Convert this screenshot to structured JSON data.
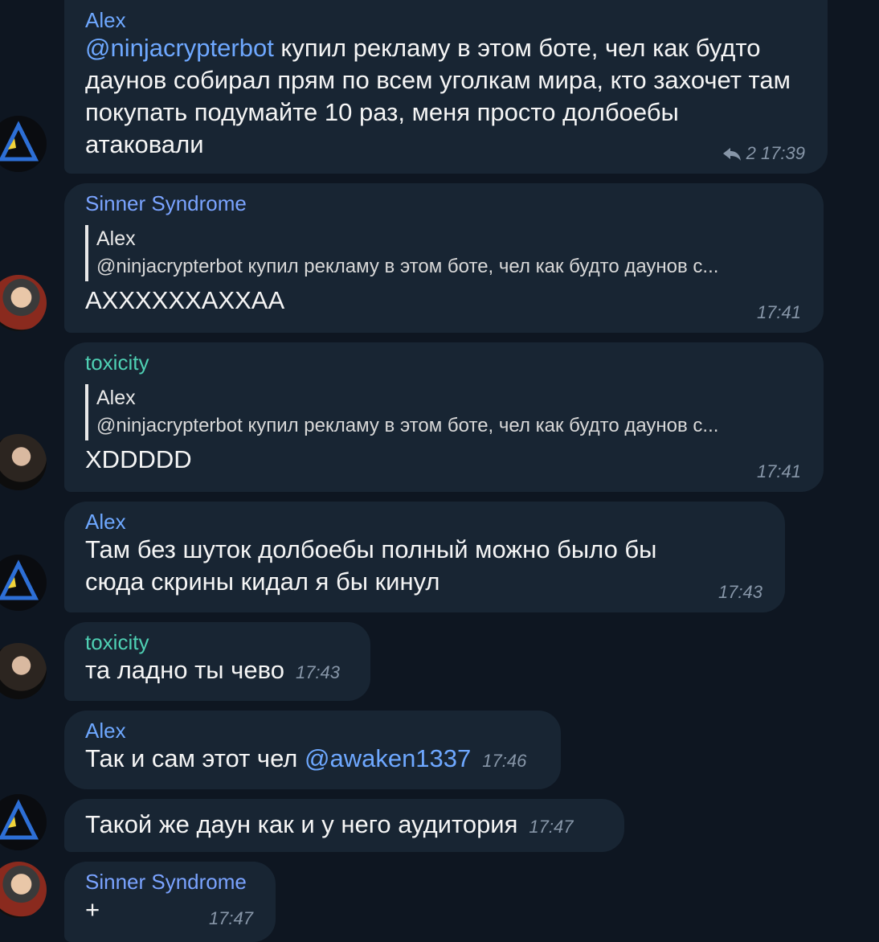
{
  "messages": [
    {
      "sender": "Alex",
      "mention": "@ninjacrypterbot",
      "text": " купил рекламу в этом боте, чел как будто даунов собирал прям по всем уголкам мира, кто захочет там покупать подумайте 10 раз, меня просто долбоебы атаковали",
      "replies": "2",
      "time": "17:39"
    },
    {
      "sender": "Sinner Syndrome",
      "quote_name": "Alex",
      "quote_text": "@ninjacrypterbot купил рекламу в этом боте, чел как будто даунов с...",
      "text": "АХХХХХХАХХАА",
      "time": "17:41"
    },
    {
      "sender": "toxicity",
      "quote_name": "Alex",
      "quote_text": "@ninjacrypterbot купил рекламу в этом боте, чел как будто даунов с...",
      "text": "XDDDDD",
      "time": "17:41"
    },
    {
      "sender": "Alex",
      "text": "Там без шуток долбоебы полный можно было бы сюда скрины кидал я бы кинул",
      "time": "17:43"
    },
    {
      "sender": "toxicity",
      "text": "та ладно ты чево",
      "time": "17:43"
    },
    {
      "sender": "Alex",
      "text": "Так и сам этот чел ",
      "mention": "@awaken1337",
      "time": "17:46"
    },
    {
      "text": "Такой же даун как и у него аудитория",
      "time": "17:47"
    },
    {
      "sender": "Sinner Syndrome",
      "text": "+",
      "time": "17:47"
    }
  ],
  "icons": {
    "reply": "reply-arrow-icon"
  },
  "colors": {
    "background": "#0e1621",
    "bubble": "#182533",
    "alex": "#6ea8ff",
    "toxicity": "#4fd1b4",
    "meta": "#8796a8"
  }
}
